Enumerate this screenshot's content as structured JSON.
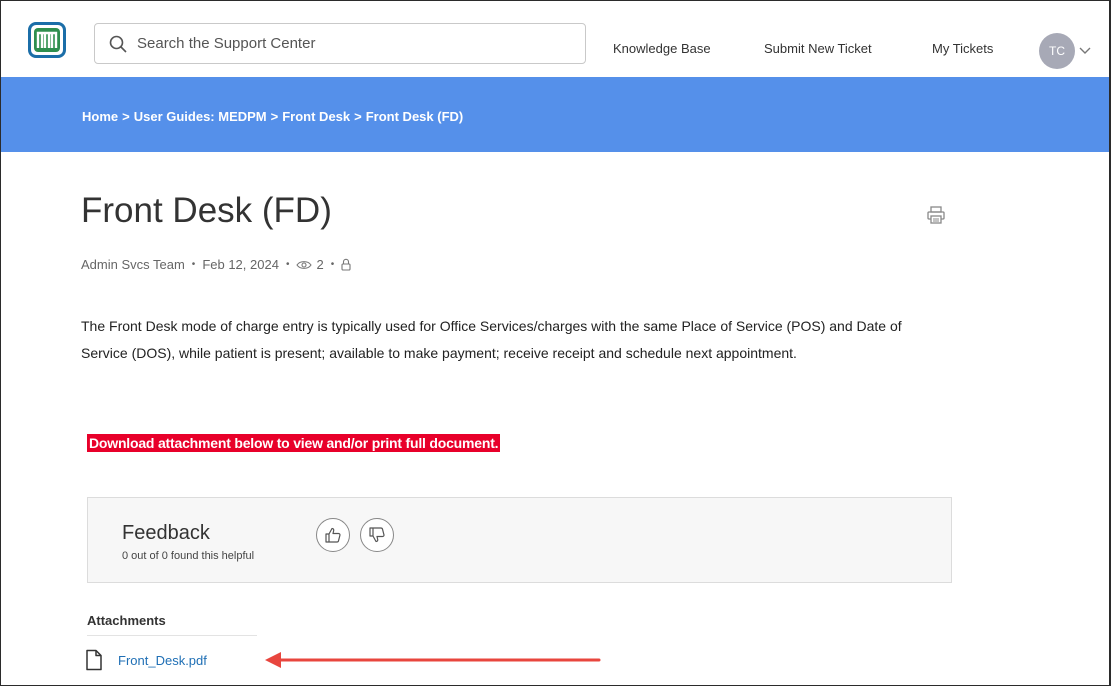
{
  "header": {
    "search_placeholder": "Search the Support Center",
    "nav": {
      "knowledge_base": "Knowledge Base",
      "submit_new_ticket": "Submit New Ticket",
      "my_tickets": "My Tickets"
    },
    "avatar_initials": "TC"
  },
  "breadcrumb": {
    "items": [
      "Home",
      "User Guides: MEDPM",
      "Front Desk",
      "Front Desk (FD)"
    ],
    "separator": ">"
  },
  "article": {
    "title": "Front Desk (FD)",
    "author": "Admin Svcs Team",
    "date": "Feb 12, 2024",
    "views": "2",
    "body": "The Front Desk mode of charge entry is typically used for Office Services/charges with the same Place of Service (POS) and Date of Service (DOS), while patient is present; available to make payment; receive receipt and schedule next appointment.",
    "highlight": "Download attachment below to view and/or print full document."
  },
  "feedback": {
    "title": "Feedback",
    "summary": "0 out of 0 found this helpful"
  },
  "attachments": {
    "heading": "Attachments",
    "files": [
      "Front_Desk.pdf"
    ]
  },
  "colors": {
    "band": "#5590ea",
    "highlight": "#e8002a",
    "link": "#1f6fb5",
    "arrow": "#e8463e"
  },
  "icons": {
    "logo": "logo-icon",
    "search": "search-icon",
    "caret": "chevron-down-icon",
    "print": "print-icon",
    "views": "eye-icon",
    "lock": "lock-icon",
    "thumbs_up": "thumbs-up-icon",
    "thumbs_down": "thumbs-down-icon",
    "file": "file-icon",
    "arrow": "arrow-left-icon"
  }
}
